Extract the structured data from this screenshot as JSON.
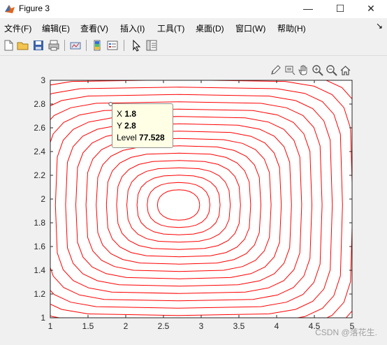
{
  "window": {
    "title": "Figure 3"
  },
  "menu": [
    {
      "label": "文件(F)"
    },
    {
      "label": "编辑(E)"
    },
    {
      "label": "查看(V)"
    },
    {
      "label": "插入(I)"
    },
    {
      "label": "工具(T)"
    },
    {
      "label": "桌面(D)"
    },
    {
      "label": "窗口(W)"
    },
    {
      "label": "帮助(H)"
    }
  ],
  "toolbar_icons": [
    "new-figure-icon",
    "open-file-icon",
    "save-icon",
    "print-icon",
    "link-plot-icon",
    "insert-colorbar-icon",
    "insert-legend-icon",
    "edit-plot-icon",
    "property-inspector-icon"
  ],
  "axes_toolbar_icons": [
    "brush-icon",
    "data-tips-icon",
    "pan-icon",
    "zoom-in-icon",
    "zoom-out-icon",
    "home-icon"
  ],
  "datatip": {
    "x_label": "X",
    "x_value": "1.8",
    "y_label": "Y",
    "y_value": "2.8",
    "level_label": "Level",
    "level_value": "77.528"
  },
  "watermark": "CSDN @落花生.",
  "colors": {
    "contour": "#ff0000",
    "axes_bg": "#ffffff",
    "figure_bg": "#f0f0f0"
  },
  "chart_data": {
    "type": "contour",
    "title": "",
    "xlabel": "",
    "ylabel": "",
    "xlim": [
      1,
      5
    ],
    "ylim": [
      1,
      3
    ],
    "xticks": [
      "1",
      "1.5",
      "2",
      "2.5",
      "3",
      "3.5",
      "4",
      "4.5",
      "5"
    ],
    "yticks": [
      "1",
      "1.2",
      "1.4",
      "1.6",
      "1.8",
      "2",
      "2.2",
      "2.4",
      "2.6",
      "2.8",
      "3"
    ],
    "center": {
      "x": 2.7,
      "y": 1.95
    },
    "levels_count": 20,
    "line_color": "#ff0000",
    "datatip_point": {
      "x": 1.8,
      "y": 2.8,
      "level": 77.528
    }
  }
}
